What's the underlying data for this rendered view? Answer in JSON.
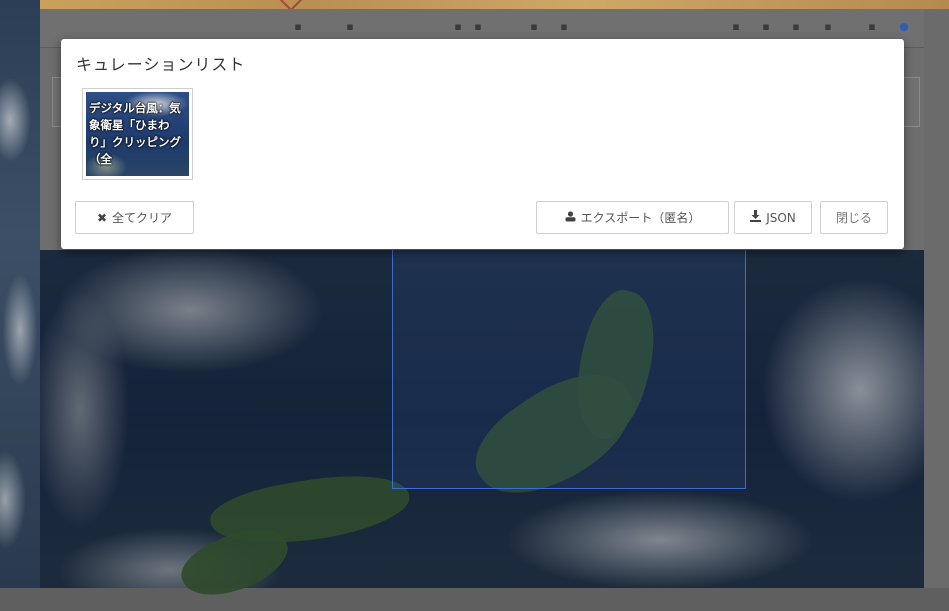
{
  "modal": {
    "title": "キュレーションリスト",
    "thumbnail": {
      "label": "デジタル台風：気象衛星「ひまわり」クリッピング（全"
    },
    "buttons": {
      "clear_all": "全てクリア",
      "export_anonymous": "エクスポート（匿名）",
      "json": "JSON",
      "close": "閉じる"
    }
  },
  "icons": {
    "clear": "close-x-icon",
    "export": "user-icon",
    "json": "download-icon"
  },
  "colors": {
    "selection_border": "#3c6ed0",
    "modal_background": "#ffffff",
    "overlay": "#6e6e6e"
  }
}
